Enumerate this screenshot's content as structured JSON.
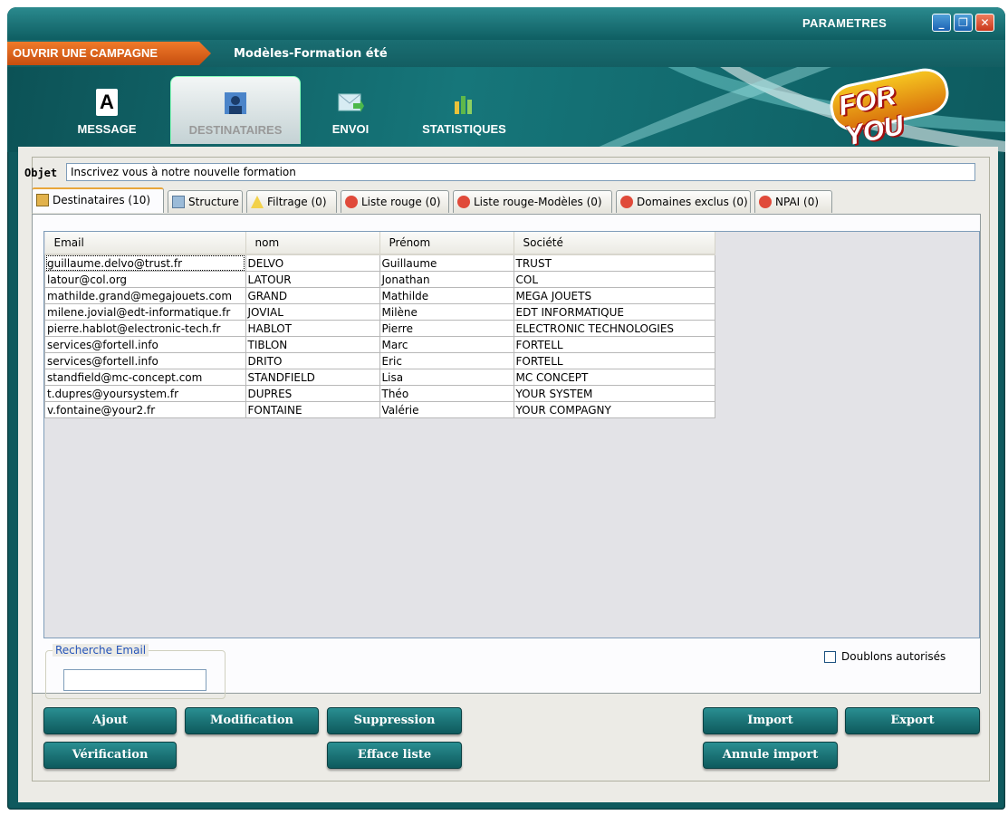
{
  "titlebar": {
    "params_label": "PARAMETRES",
    "min": "_",
    "max": "❐",
    "close": "✕"
  },
  "campaign": {
    "open_label": "OUVRIR UNE CAMPAGNE",
    "name": "Modèles-Formation été"
  },
  "logo_text": "FOR YOU",
  "nav_tabs": [
    {
      "label": "MESSAGE",
      "icon": "letter-a-icon"
    },
    {
      "label": "DESTINATAIRES",
      "icon": "recipients-icon"
    },
    {
      "label": "ENVOI",
      "icon": "send-envelope-icon"
    },
    {
      "label": "STATISTIQUES",
      "icon": "bar-chart-icon"
    }
  ],
  "subject": {
    "label": "Objet",
    "value": "Inscrivez vous à notre nouvelle formation"
  },
  "subtabs": [
    {
      "label": "Destinataires (10)"
    },
    {
      "label": "Structure"
    },
    {
      "label": "Filtrage (0)"
    },
    {
      "label": "Liste rouge (0)"
    },
    {
      "label": "Liste rouge-Modèles (0)"
    },
    {
      "label": "Domaines exclus (0)"
    },
    {
      "label": "NPAI (0)"
    }
  ],
  "table": {
    "headers": [
      "Email",
      "nom",
      "Prénom",
      "Société"
    ],
    "rows": [
      [
        "guillaume.delvo@trust.fr",
        "DELVO",
        "Guillaume",
        "TRUST"
      ],
      [
        "latour@col.org",
        "LATOUR",
        "Jonathan",
        "COL"
      ],
      [
        "mathilde.grand@megajouets.com",
        "GRAND",
        "Mathilde",
        "MEGA JOUETS"
      ],
      [
        "milene.jovial@edt-informatique.fr",
        "JOVIAL",
        "Milène",
        "EDT INFORMATIQUE"
      ],
      [
        "pierre.hablot@electronic-tech.fr",
        "HABLOT",
        "Pierre",
        "ELECTRONIC TECHNOLOGIES"
      ],
      [
        "services@fortell.info",
        "TIBLON",
        "Marc",
        "FORTELL"
      ],
      [
        "services@fortell.info",
        "DRITO",
        "Eric",
        "FORTELL"
      ],
      [
        "standfield@mc-concept.com",
        "STANDFIELD",
        "Lisa",
        "MC CONCEPT"
      ],
      [
        "t.dupres@yoursystem.fr",
        "DUPRES",
        "Théo",
        "YOUR SYSTEM"
      ],
      [
        "v.fontaine@your2.fr",
        "FONTAINE",
        "Valérie",
        "YOUR COMPAGNY"
      ]
    ]
  },
  "search": {
    "legend": "Recherche Email",
    "value": ""
  },
  "duplicates": {
    "label": "Doublons autorisés",
    "checked": false
  },
  "buttons": {
    "ajout": "Ajout",
    "modification": "Modification",
    "suppression": "Suppression",
    "import": "Import",
    "export": "Export",
    "verification": "Vérification",
    "efface": "Efface liste",
    "annule": "Annule import"
  },
  "colors": {
    "teal": "#0f5a5e",
    "orange": "#e86a1c",
    "panel": "#ecebe6"
  }
}
